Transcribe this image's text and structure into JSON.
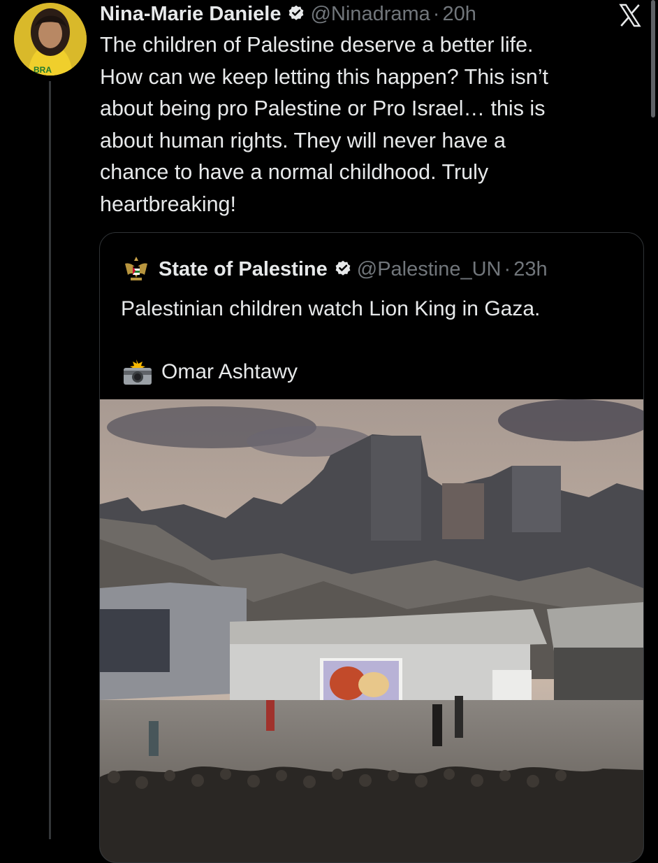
{
  "tweet": {
    "author_name": "Nina-Marie Daniele",
    "handle": "@Ninadrama",
    "separator": "·",
    "time": "20h",
    "verified": true,
    "avatar_icon": "profile-photo",
    "text": "The children of Palestine deserve a better life.\nHow can we keep letting this happen? This isn’t\nabout being pro Palestine or Pro Israel… this is\nabout human rights. They will never have a\nchance to have a normal childhood. Truly\nheartbreaking!"
  },
  "quote": {
    "author_name": "State of Palestine",
    "handle": "@Palestine_UN",
    "separator": "·",
    "time": "23h",
    "verified": true,
    "logo_icon": "palestine-coat-of-arms-icon",
    "text": "Palestinian children watch Lion King in Gaza.",
    "credit_icon": "camera-flash-icon",
    "credit": "Omar Ashtawy",
    "image_alt": "Children sitting outdoors watching a projected film among destroyed buildings in Gaza"
  },
  "colors": {
    "background": "#000000",
    "text_primary": "#e7e9ea",
    "text_secondary": "#71767b",
    "verified_blue": "#1d9bf0",
    "border": "#2f3336"
  }
}
